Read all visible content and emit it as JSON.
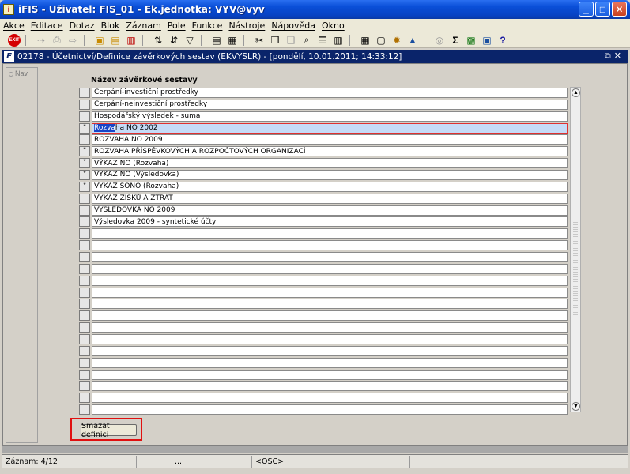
{
  "window": {
    "app_icon": "iFIS-app-icon",
    "title": "iFIS - Uživatel: FIS_01 - Ek.jednotka: VYV@vyv",
    "buttons": {
      "minimize": "_",
      "maximize": "□",
      "close": "✕"
    }
  },
  "menu": [
    "Akce",
    "Editace",
    "Dotaz",
    "Blok",
    "Záznam",
    "Pole",
    "Funkce",
    "Nástroje",
    "Nápověda",
    "Okno"
  ],
  "toolbar": {
    "exit_label": "EXIT",
    "icons": [
      "exit-icon",
      "save-icon",
      "print-icon",
      "fetch-icon",
      "insert-record-icon",
      "delete-record-icon",
      "sort-asc-icon",
      "sort-desc-icon",
      "filter-icon",
      "print-preview-icon",
      "export-icon",
      "cut-icon",
      "copy-icon",
      "paste-icon",
      "search-icon",
      "list-icon",
      "calculator-icon",
      "clock-icon",
      "sun-icon",
      "triangle-icon",
      "help-circle-icon",
      "sum-icon",
      "excel-icon",
      "report-icon",
      "whats-this-icon"
    ]
  },
  "form": {
    "title": "02178 - Účetnictví/Definice závěrkových sestav (EKVYSLR) - [pondělí, 10.01.2011; 14:33:12]",
    "icon": "form-f-icon",
    "nav_label": "Nav",
    "column_header": "Název závěrkové sestavy",
    "rows": [
      {
        "marker": "",
        "name": "Čerpání-investiční prostředky"
      },
      {
        "marker": "",
        "name": "Čerpání-neinvestiční prostředky"
      },
      {
        "marker": "",
        "name": "Hospodářský výsledek - suma"
      },
      {
        "marker": "*",
        "name_highlight": "Rozva",
        "name_rest": "ha NO 2002",
        "selected": true
      },
      {
        "marker": "",
        "name": "ROZVAHA NO 2009"
      },
      {
        "marker": "*",
        "name": "ROZVAHA PŘÍSPĚVKOVÝCH A ROZPOČTOVÝCH ORGANIZACÍ"
      },
      {
        "marker": "*",
        "name": "VÝKAZ NO (Rozvaha)"
      },
      {
        "marker": "*",
        "name": "VÝKAZ NO (Výsledovka)"
      },
      {
        "marker": "*",
        "name": "VÝKAZ SONO (Rozvaha)"
      },
      {
        "marker": "",
        "name": "VÝKAZ ZISKŮ A ZTRÁT"
      },
      {
        "marker": "",
        "name": "VÝSLEDOVKA NO 2009"
      },
      {
        "marker": "",
        "name": "Výsledovka 2009 - syntetické účty"
      }
    ],
    "empty_rows": 16,
    "delete_button": "Smazat definici"
  },
  "status": {
    "record": "Záznam: 4/12",
    "dots": "...",
    "mode": "<OSC>"
  }
}
